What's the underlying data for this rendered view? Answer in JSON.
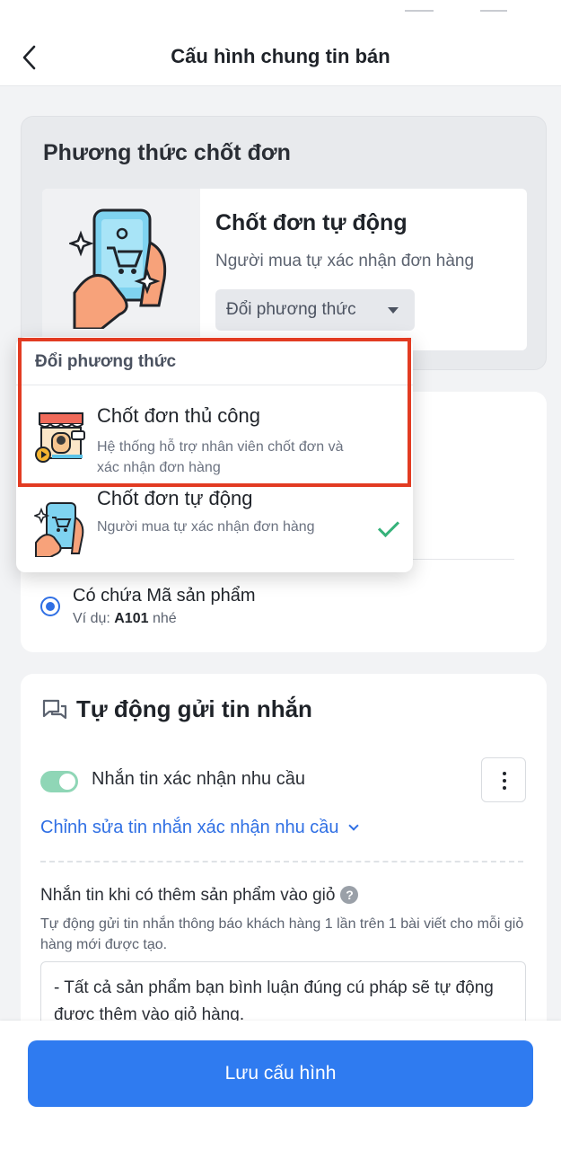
{
  "header": {
    "title": "Cấu hình chung tin bán"
  },
  "closing_method": {
    "section_title": "Phương thức chốt đơn",
    "current_name": "Chốt đơn tự động",
    "current_desc": "Người mua tự xác nhận đơn hàng",
    "change_label": "Đổi phương thức"
  },
  "dropdown": {
    "header": "Đổi phương thức",
    "items": [
      {
        "title": "Chốt đơn thủ công",
        "desc": "Hệ thống hỗ trợ nhân viên chốt đơn và xác nhận đơn hàng",
        "selected": false
      },
      {
        "title": "Chốt đơn tự động",
        "desc": "Người mua tự xác nhận đơn hàng",
        "selected": true
      }
    ]
  },
  "product_code": {
    "option_title": "Có chứa Mã sản phẩm",
    "example_prefix": "Ví dụ: ",
    "example_code": "A101",
    "example_suffix": " nhé"
  },
  "auto_message": {
    "title": "Tự động gửi tin nhắn",
    "toggle_label": "Nhắn tin xác nhận nhu cầu",
    "toggle_on": true,
    "edit_link": "Chỉnh sửa tin nhắn xác nhận nhu cầu",
    "cart_title": "Nhắn tin khi có thêm sản phẩm vào giỏ",
    "help_glyph": "?",
    "cart_desc": "Tự động gửi tin nhắn thông báo khách hàng 1 lần trên 1 bài viết cho mỗi giỏ hàng mới được tạo.",
    "message_text": "- Tất cả sản phẩm bạn bình luận đúng cú pháp sẽ tự động được thêm vào giỏ hàng."
  },
  "footer": {
    "save_label": "Lưu cấu hình"
  },
  "colors": {
    "primary": "#2f7bf0",
    "highlight": "#e23b22",
    "success": "#35b27a",
    "toggle": "#8fd6b6"
  },
  "icons": [
    "chevron-left-icon",
    "caret-down-icon",
    "chat-icon",
    "more-vertical-icon",
    "help-icon",
    "check-icon",
    "storefront-icon",
    "phone-cart-icon"
  ]
}
